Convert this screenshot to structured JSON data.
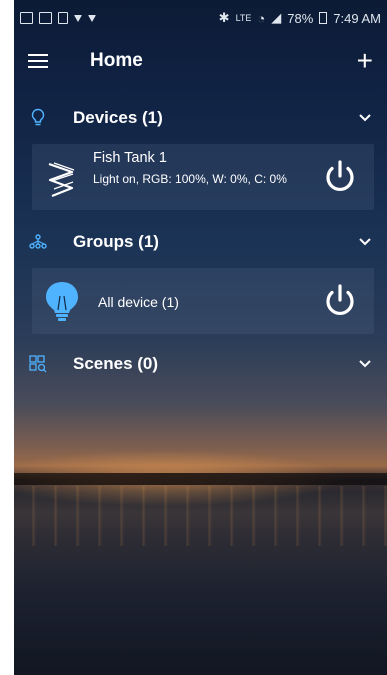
{
  "status_bar": {
    "battery": "78%",
    "time": "7:49 AM"
  },
  "app_bar": {
    "title": "Home",
    "add_glyph": "+"
  },
  "sections": {
    "devices": {
      "title": "Devices (1)",
      "icon": "lightbulb-outline-icon"
    },
    "groups": {
      "title": "Groups (1)",
      "icon": "network-icon"
    },
    "scenes": {
      "title": "Scenes (0)",
      "icon": "scenes-grid-icon"
    }
  },
  "devices": [
    {
      "name": "Fish Tank 1",
      "status": "Light on, RGB: 100%, W: 0%, C: 0%",
      "icon": "led-strip-icon"
    }
  ],
  "groups": [
    {
      "name": "All device (1)",
      "icon": "bulb-filled-icon"
    }
  ],
  "colors": {
    "accent": "#4fb3ff",
    "text": "#ffffff"
  }
}
